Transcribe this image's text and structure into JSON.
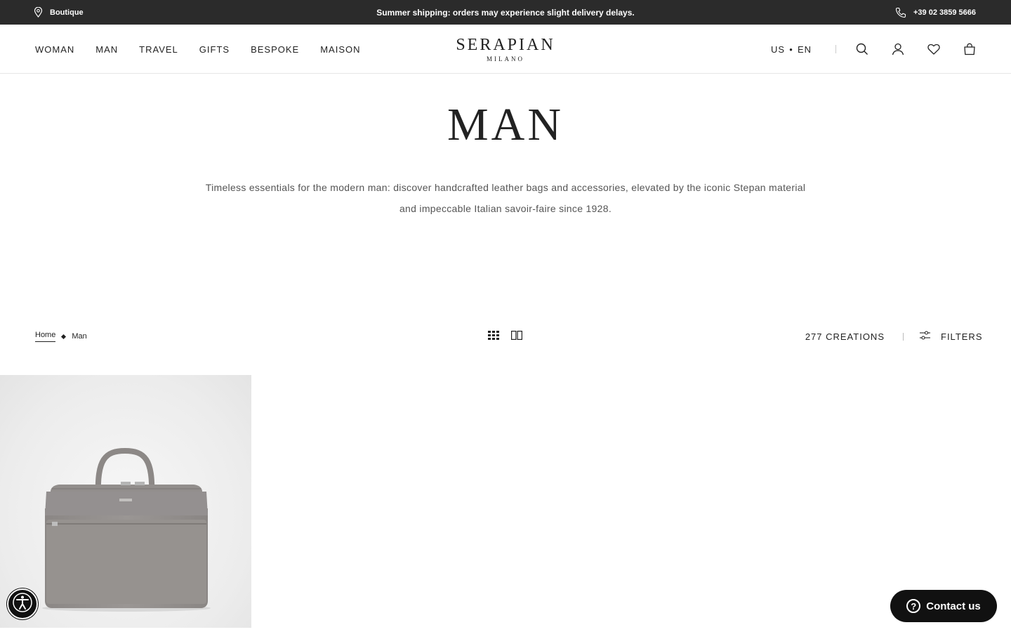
{
  "topbar": {
    "boutique_label": "Boutique",
    "announcement": "Summer shipping: orders may experience slight delivery delays.",
    "phone": "+39 02 3859 5666",
    "icons": [
      "location-pin-icon",
      "phone-icon"
    ]
  },
  "header": {
    "nav": [
      {
        "label": "WOMAN"
      },
      {
        "label": "MAN"
      },
      {
        "label": "TRAVEL"
      },
      {
        "label": "GIFTS"
      },
      {
        "label": "BESPOKE"
      },
      {
        "label": "MAISON"
      }
    ],
    "logo": {
      "brand": "SERAPIAN",
      "sub": "MILANO"
    },
    "locale": {
      "country": "US",
      "language": "EN"
    },
    "icons": [
      "search-icon",
      "account-icon",
      "wishlist-heart-icon",
      "shopping-bag-icon"
    ]
  },
  "hero": {
    "title": "MAN",
    "description": "Timeless essentials for the modern man: discover handcrafted leather bags and accessories, elevated by the iconic Stepan material and impeccable Italian savoir-faire since 1928."
  },
  "toolbar": {
    "breadcrumb": [
      {
        "label": "Home"
      },
      {
        "label": "Man"
      }
    ],
    "view_modes": [
      "grid-small-icon",
      "grid-large-icon"
    ],
    "count": "277 CREATIONS",
    "filters_label": "FILTERS"
  },
  "product_grid": {
    "items": [
      {
        "image": "grey-leather-briefcase",
        "color": "#8f8b89"
      }
    ]
  },
  "floating": {
    "contact_label": "Contact us",
    "accessibility": "accessibility-icon"
  },
  "colors": {
    "topbar_bg": "#2b2b2b",
    "text": "#222222",
    "button_bg": "#111111"
  }
}
